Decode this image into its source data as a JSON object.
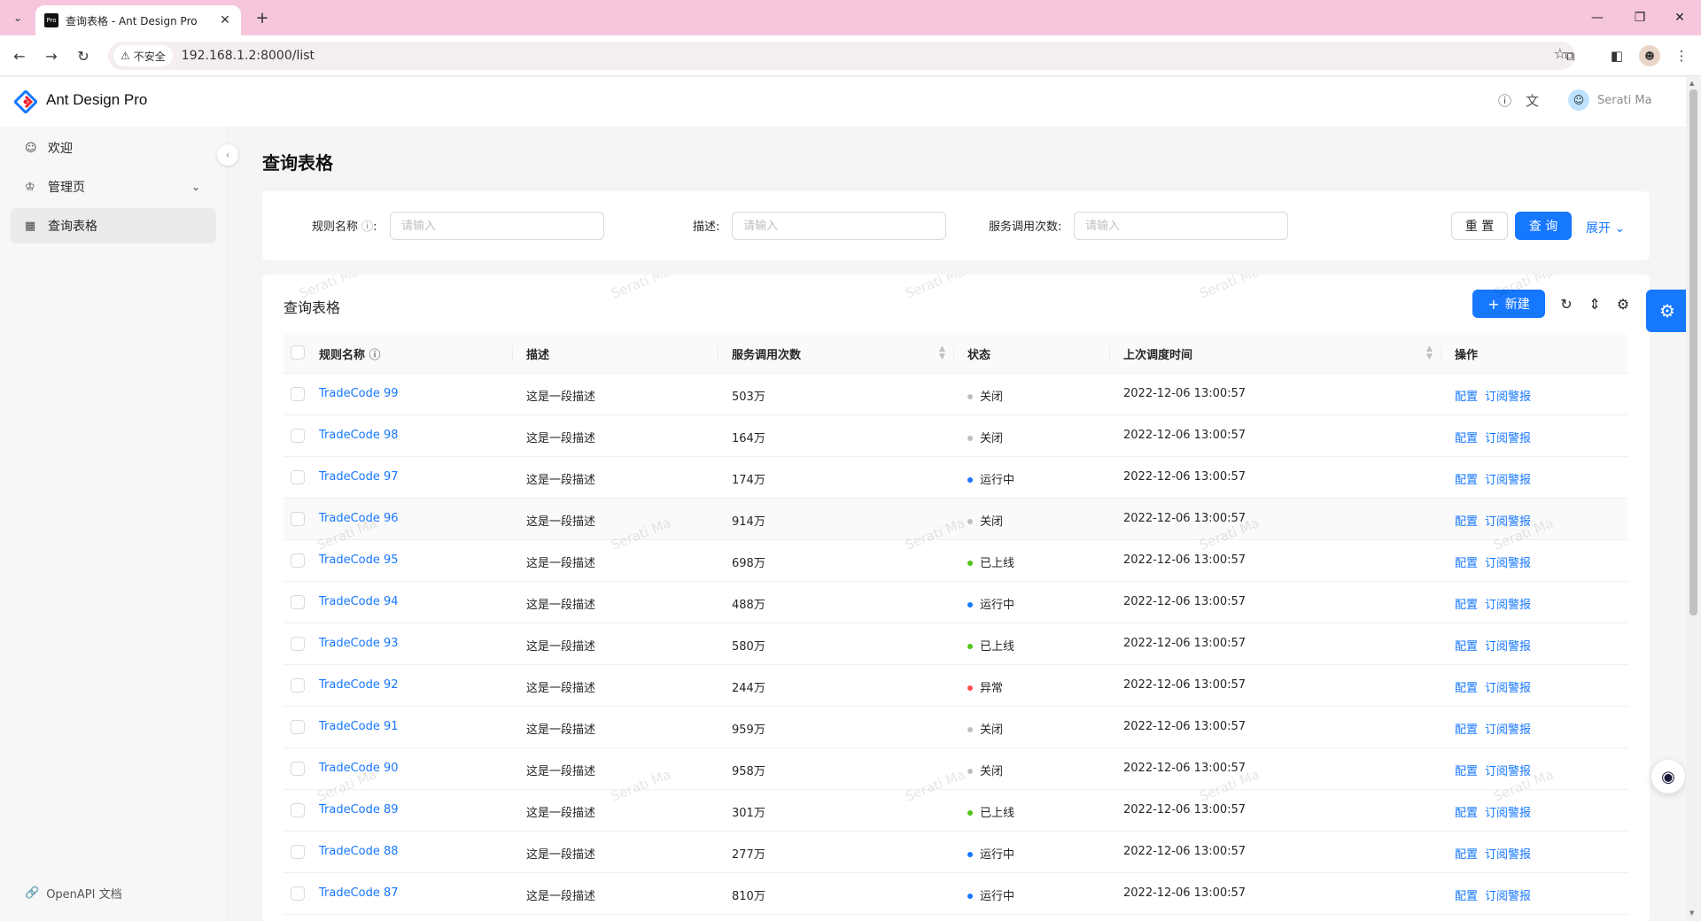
{
  "browser": {
    "tab_title": "查询表格 - Ant Design Pro",
    "favicon_text": "Pro",
    "security_label": "不安全",
    "url": "192.168.1.2:8000/list"
  },
  "app": {
    "brand": "Ant Design Pro",
    "user_name": "Serati Ma",
    "watermark": "Serati Ma"
  },
  "sidebar": {
    "items": [
      {
        "label": "欢迎",
        "icon": "smile-icon"
      },
      {
        "label": "管理页",
        "icon": "crown-icon"
      },
      {
        "label": "查询表格",
        "icon": "table-icon"
      }
    ],
    "footer": "OpenAPI 文档"
  },
  "page": {
    "title": "查询表格"
  },
  "search": {
    "rule_label": "规则名称",
    "desc_label": "描述:",
    "calls_label": "服务调用次数:",
    "placeholder": "请输入",
    "reset": "重 置",
    "query": "查 询",
    "expand": "展开"
  },
  "table": {
    "title": "查询表格",
    "new_button": "新建",
    "columns": [
      "规则名称",
      "描述",
      "服务调用次数",
      "状态",
      "上次调度时间",
      "操作"
    ],
    "actions": [
      "配置",
      "订阅警报"
    ],
    "status_colors": {
      "关闭": "#bfbfbf",
      "运行中": "#1677ff",
      "已上线": "#52c41a",
      "异常": "#ff4d4f"
    },
    "rows": [
      {
        "name": "TradeCode 99",
        "desc": "这是一段描述",
        "calls": "503万",
        "status": "关闭",
        "time": "2022-12-06 13:00:57"
      },
      {
        "name": "TradeCode 98",
        "desc": "这是一段描述",
        "calls": "164万",
        "status": "关闭",
        "time": "2022-12-06 13:00:57"
      },
      {
        "name": "TradeCode 97",
        "desc": "这是一段描述",
        "calls": "174万",
        "status": "运行中",
        "time": "2022-12-06 13:00:57"
      },
      {
        "name": "TradeCode 96",
        "desc": "这是一段描述",
        "calls": "914万",
        "status": "关闭",
        "time": "2022-12-06 13:00:57"
      },
      {
        "name": "TradeCode 95",
        "desc": "这是一段描述",
        "calls": "698万",
        "status": "已上线",
        "time": "2022-12-06 13:00:57"
      },
      {
        "name": "TradeCode 94",
        "desc": "这是一段描述",
        "calls": "488万",
        "status": "运行中",
        "time": "2022-12-06 13:00:57"
      },
      {
        "name": "TradeCode 93",
        "desc": "这是一段描述",
        "calls": "580万",
        "status": "已上线",
        "time": "2022-12-06 13:00:57"
      },
      {
        "name": "TradeCode 92",
        "desc": "这是一段描述",
        "calls": "244万",
        "status": "异常",
        "time": "2022-12-06 13:00:57"
      },
      {
        "name": "TradeCode 91",
        "desc": "这是一段描述",
        "calls": "959万",
        "status": "关闭",
        "time": "2022-12-06 13:00:57"
      },
      {
        "name": "TradeCode 90",
        "desc": "这是一段描述",
        "calls": "958万",
        "status": "关闭",
        "time": "2022-12-06 13:00:57"
      },
      {
        "name": "TradeCode 89",
        "desc": "这是一段描述",
        "calls": "301万",
        "status": "已上线",
        "time": "2022-12-06 13:00:57"
      },
      {
        "name": "TradeCode 88",
        "desc": "这是一段描述",
        "calls": "277万",
        "status": "运行中",
        "time": "2022-12-06 13:00:57"
      },
      {
        "name": "TradeCode 87",
        "desc": "这是一段描述",
        "calls": "810万",
        "status": "运行中",
        "time": "2022-12-06 13:00:57"
      }
    ]
  }
}
